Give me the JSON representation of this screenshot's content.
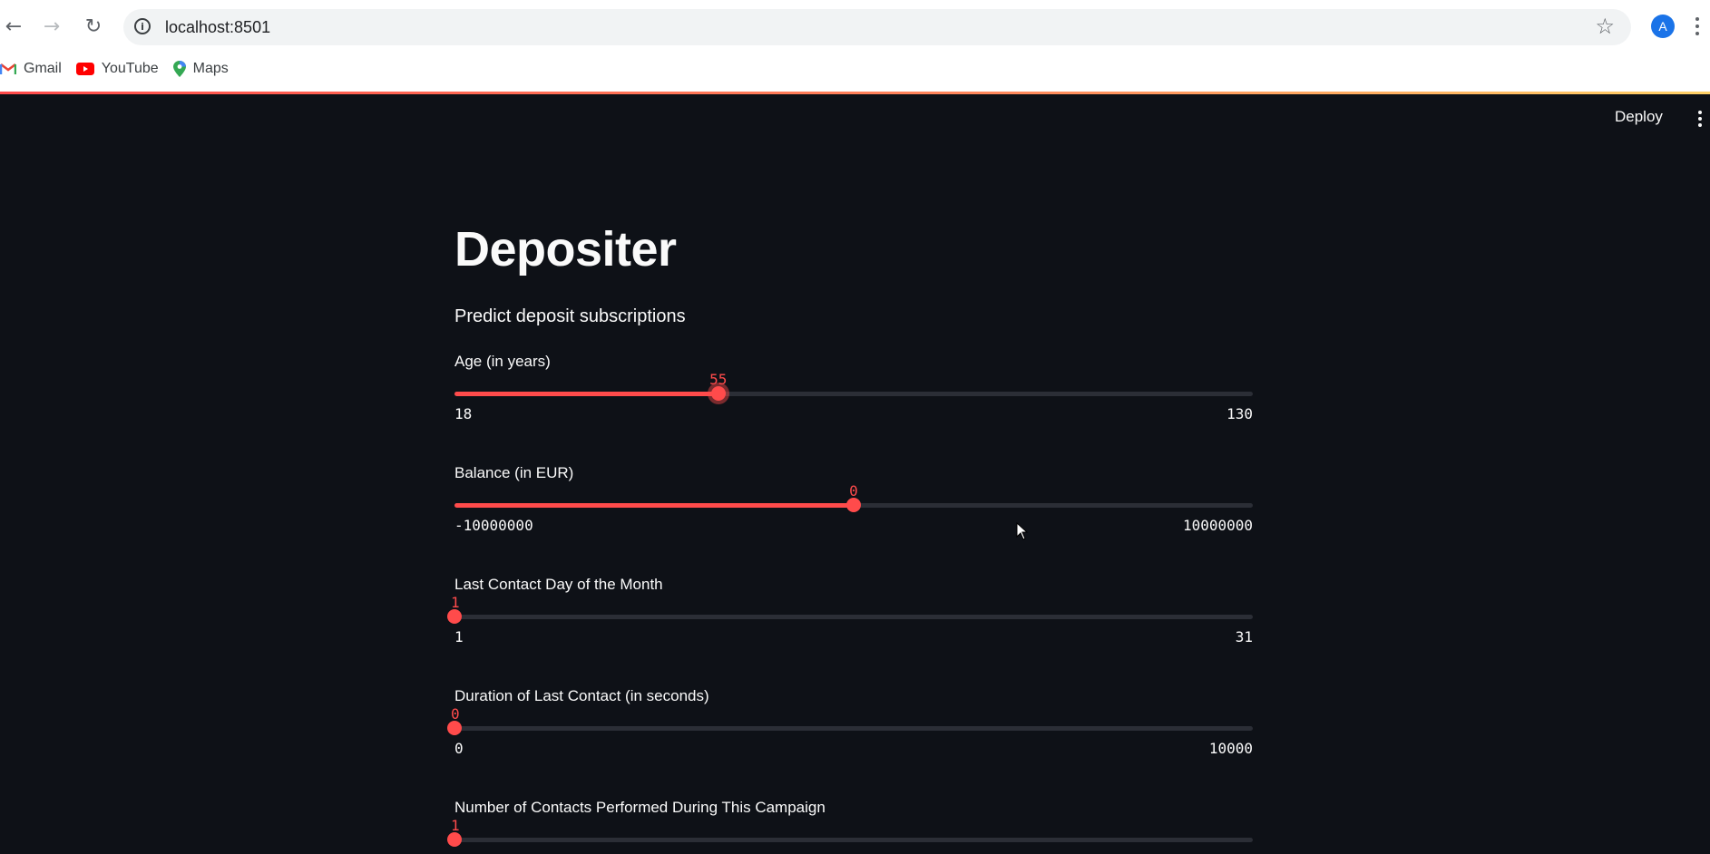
{
  "browser": {
    "url": "localhost:8501",
    "avatar_letter": "A",
    "bookmarks": [
      {
        "label": "Gmail",
        "icon": "gmail-icon"
      },
      {
        "label": "YouTube",
        "icon": "youtube-icon"
      },
      {
        "label": "Maps",
        "icon": "maps-icon"
      }
    ]
  },
  "app": {
    "deploy_label": "Deploy",
    "title": "Depositer",
    "subtitle": "Predict deposit subscriptions",
    "accent_color": "#ff4b4b",
    "background_color": "#0e1117",
    "sliders": [
      {
        "label": "Age (in years)",
        "min": 18,
        "max": 130,
        "value": 55,
        "min_label": "18",
        "max_label": "130",
        "value_label": "55",
        "focused": true
      },
      {
        "label": "Balance (in EUR)",
        "min": -10000000,
        "max": 10000000,
        "value": 0,
        "min_label": "-10000000",
        "max_label": "10000000",
        "value_label": "0",
        "focused": false
      },
      {
        "label": "Last Contact Day of the Month",
        "min": 1,
        "max": 31,
        "value": 1,
        "min_label": "1",
        "max_label": "31",
        "value_label": "1",
        "focused": false
      },
      {
        "label": "Duration of Last Contact (in seconds)",
        "min": 0,
        "max": 10000,
        "value": 0,
        "min_label": "0",
        "max_label": "10000",
        "value_label": "0",
        "focused": false
      },
      {
        "label": "Number of Contacts Performed During This Campaign",
        "value_label": "1",
        "value": 0,
        "min": 0,
        "max": 1,
        "partial": true
      }
    ]
  }
}
